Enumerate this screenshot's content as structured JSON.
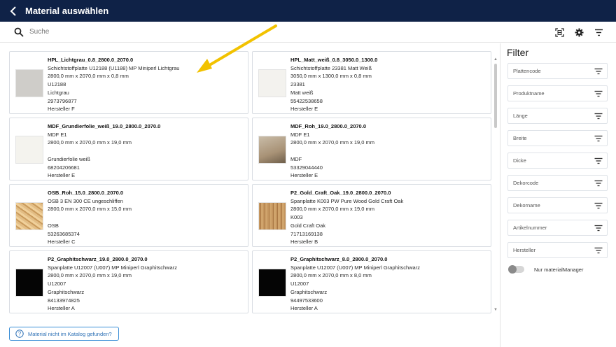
{
  "header": {
    "title": "Material auswählen",
    "back_icon": "chevron-left-icon"
  },
  "search": {
    "placeholder": "Suche",
    "value": ""
  },
  "toolbar": {
    "icons": [
      "barcode-scan-icon",
      "gear-icon",
      "filter-lines-icon"
    ]
  },
  "materials": [
    {
      "name": "HPL_Lichtgrau_0.8_2800.0_2070.0",
      "desc": "Schichtstoffplatte U12188 (U1188) MP Miniperl Lichtgrau",
      "dims": "2800,0 mm x 2070,0 mm x 0,8 mm",
      "code": "U12188",
      "decor": "Lichtgrau",
      "number": "2973796877",
      "maker": "Hersteller F",
      "color": "#cfcdc9"
    },
    {
      "name": "HPL_Matt_weiß_0.8_3050.0_1300.0",
      "desc": "Schichtstoffplatte 23381 Matt Weiß",
      "dims": "3050,0 mm x 1300,0 mm x 0,8 mm",
      "code": "23381",
      "decor": "Matt weiß",
      "number": "55422538658",
      "maker": "Hersteller E",
      "color": "#f3f2ee"
    },
    {
      "name": "MDF_Grundierfolie_weiß_19.0_2800.0_2070.0",
      "desc": "MDF E1",
      "dims": "2800,0 mm x 2070,0 mm x 19,0 mm",
      "code": "",
      "decor": "Grundierfolie weiß",
      "number": "68204206681",
      "maker": "Hersteller E",
      "color": "#f4f3ee"
    },
    {
      "name": "MDF_Roh_19.0_2800.0_2070.0",
      "desc": "MDF E1",
      "dims": "2800,0 mm x 2070,0 mm x 19,0 mm",
      "code": "",
      "decor": "MDF",
      "number": "53329044440",
      "maker": "Hersteller E",
      "color": "#b9a78d"
    },
    {
      "name": "OSB_Roh_15.0_2800.0_2070.0",
      "desc": "OSB 3 EN 300 CE ungeschliffen",
      "dims": "2800,0 mm x 2070,0 mm x 15,0 mm",
      "code": "",
      "decor": "OSB",
      "number": "53263685374",
      "maker": "Hersteller C",
      "color": "#d5ae73"
    },
    {
      "name": "P2_Gold_Craft_Oak_19.0_2800.0_2070.0",
      "desc": "Spanplatte K003 PW Pure Wood Gold Craft Oak",
      "dims": "2800,0 mm x 2070,0 mm x 19,0 mm",
      "code": "K003",
      "decor": "Gold Craft Oak",
      "number": "71713169138",
      "maker": "Hersteller B",
      "color": "#b98c57"
    },
    {
      "name": "P2_Graphitschwarz_19.0_2800.0_2070.0",
      "desc": "Spanplatte U12007 (U007) MP Miniperl Graphitschwarz",
      "dims": "2800,0 mm x 2070,0 mm x 19,0 mm",
      "code": "U12007",
      "decor": "Graphitschwarz",
      "number": "84133974825",
      "maker": "Hersteller A",
      "color": "#050505"
    },
    {
      "name": "P2_Graphitschwarz_8.0_2800.0_2070.0",
      "desc": "Spanplatte U12007 (U007) MP Miniperl Graphitschwarz",
      "dims": "2800,0 mm x 2070,0 mm x 8,0 mm",
      "code": "U12007",
      "decor": "Graphitschwarz",
      "number": "94497533600",
      "maker": "Hersteller A",
      "color": "#050505"
    }
  ],
  "filter": {
    "title": "Filter",
    "fields": [
      "Plattencode",
      "Produktname",
      "Länge",
      "Breite",
      "Dicke",
      "Dekorcode",
      "Dekorname",
      "Artikelnummer",
      "Hersteller"
    ],
    "toggle_label": "Nur materialManager",
    "toggle_on": false
  },
  "not_found_button": {
    "label": "Material nicht im Katalog gefunden?",
    "icon": "question-circle-icon"
  },
  "annotation": {
    "arrow_color": "#f2c200"
  }
}
